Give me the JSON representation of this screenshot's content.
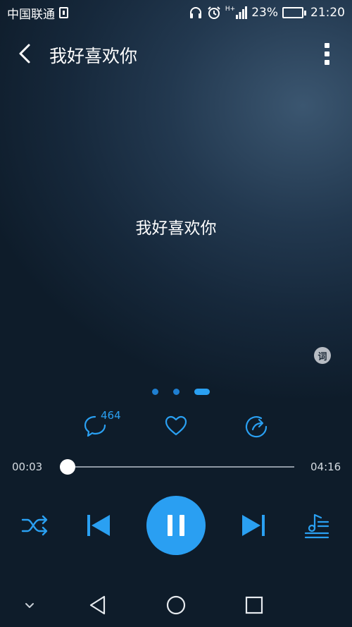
{
  "status_bar": {
    "carrier": "中国联通",
    "battery_percent": "23%",
    "battery_level": 0.23,
    "time": "21:20",
    "network_label": "H+"
  },
  "header": {
    "title": "我好喜欢你",
    "back_icon": "chevron-left-icon",
    "more_icon": "more-vertical-icon"
  },
  "lyrics": {
    "current_line": "我好喜欢你",
    "toggle_label": "词"
  },
  "pager": {
    "count": 3,
    "active_index": 2
  },
  "actions": {
    "comment_count": "464",
    "comment_icon": "comment-icon",
    "like_icon": "heart-icon",
    "share_icon": "share-icon"
  },
  "progress": {
    "elapsed": "00:03",
    "duration": "04:16",
    "fraction": 0.012
  },
  "controls": {
    "shuffle_icon": "shuffle-icon",
    "prev_icon": "skip-previous-icon",
    "play_state_icon": "pause-icon",
    "next_icon": "skip-next-icon",
    "playlist_icon": "playlist-icon"
  },
  "colors": {
    "accent": "#2aa0f2",
    "background_dark": "#0e1c2a",
    "background_light": "#3b5670"
  },
  "nav_bar": {
    "collapse_icon": "chevron-down-icon",
    "back_icon": "nav-back-icon",
    "home_icon": "nav-home-icon",
    "recents_icon": "nav-recents-icon"
  }
}
